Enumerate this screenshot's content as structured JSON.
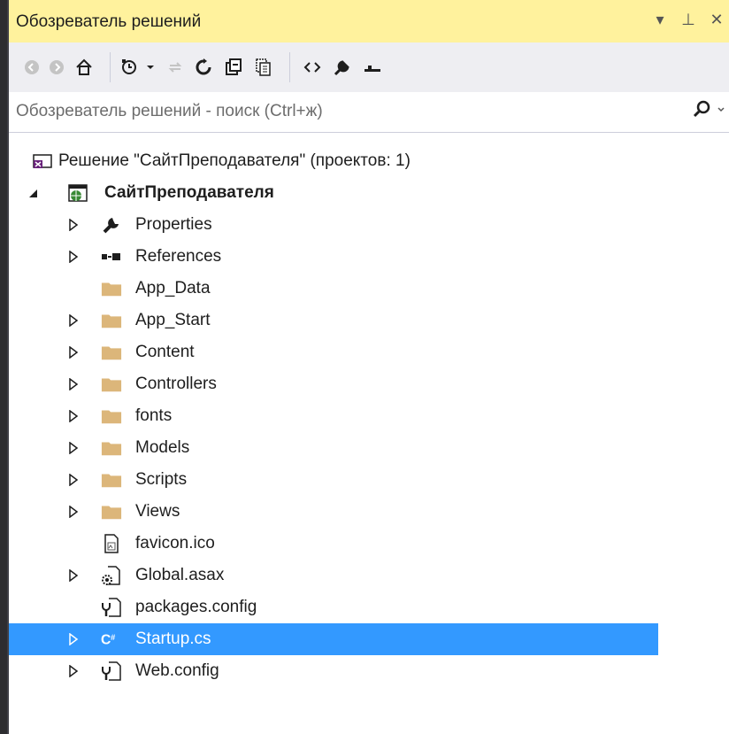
{
  "panel": {
    "title": "Обозреватель решений",
    "controls": {
      "dropdown": "▾",
      "pin": "⊥",
      "close": "✕"
    }
  },
  "toolbar": {
    "buttons": [
      "back-icon",
      "forward-icon",
      "home-icon",
      "pending-changes-icon",
      "sync-icon",
      "refresh-icon",
      "collapse-all-icon",
      "show-all-files-icon",
      "view-code-icon",
      "properties-icon",
      "preview-icon"
    ]
  },
  "search": {
    "placeholder": "Обозреватель решений - поиск (Ctrl+ж)"
  },
  "tree": {
    "solution": {
      "label": "Решение \"СайтПреподавателя\"  (проектов: 1)"
    },
    "project": {
      "label": "СайтПреподавателя"
    },
    "items": [
      {
        "label": "Properties",
        "icon": "wrench-icon",
        "expandable": true
      },
      {
        "label": "References",
        "icon": "references-icon",
        "expandable": true
      },
      {
        "label": "App_Data",
        "icon": "folder-icon",
        "expandable": false
      },
      {
        "label": "App_Start",
        "icon": "folder-icon",
        "expandable": true
      },
      {
        "label": "Content",
        "icon": "folder-icon",
        "expandable": true
      },
      {
        "label": "Controllers",
        "icon": "folder-icon",
        "expandable": true
      },
      {
        "label": "fonts",
        "icon": "folder-icon",
        "expandable": true
      },
      {
        "label": "Models",
        "icon": "folder-icon",
        "expandable": true
      },
      {
        "label": "Scripts",
        "icon": "folder-icon",
        "expandable": true
      },
      {
        "label": "Views",
        "icon": "folder-icon",
        "expandable": true
      },
      {
        "label": "favicon.ico",
        "icon": "image-file-icon",
        "expandable": false
      },
      {
        "label": "Global.asax",
        "icon": "asax-file-icon",
        "expandable": true
      },
      {
        "label": "packages.config",
        "icon": "config-file-icon",
        "expandable": false
      },
      {
        "label": "Startup.cs",
        "icon": "csharp-file-icon",
        "expandable": true,
        "selected": true
      },
      {
        "label": "Web.config",
        "icon": "config-file-icon",
        "expandable": true
      }
    ]
  },
  "colors": {
    "titlebar": "#fff29d",
    "toolbar": "#eeeef2",
    "selection": "#3399ff",
    "folder": "#dcb67a"
  }
}
